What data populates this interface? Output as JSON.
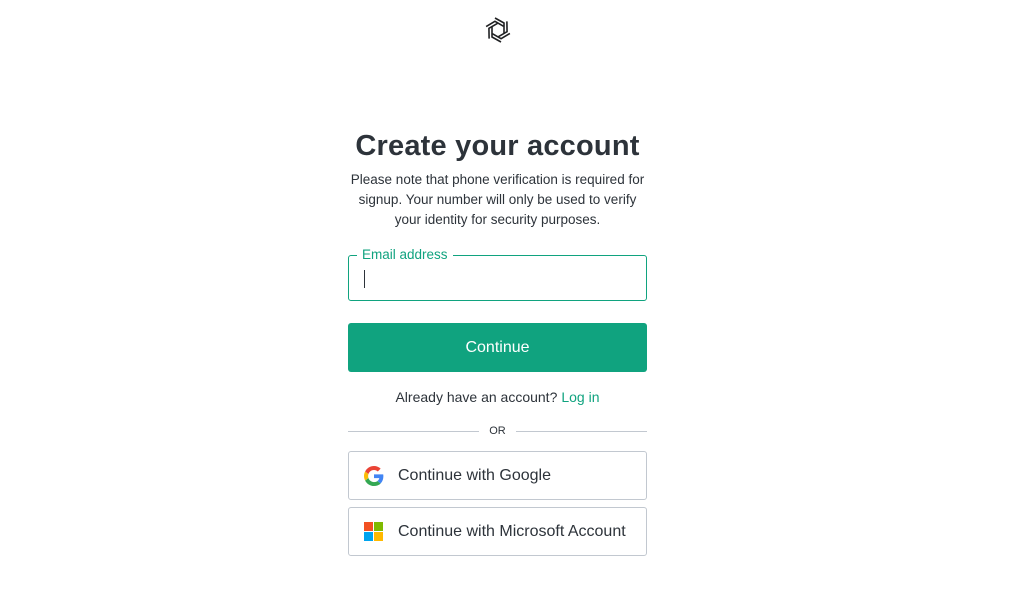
{
  "brand": {
    "logo_icon": "openai-logo-icon"
  },
  "header": {
    "title": "Create your account",
    "subtitle": "Please note that phone verification is required for signup. Your number will only be used to verify your identity for security purposes."
  },
  "form": {
    "email_label": "Email address",
    "email_value": "",
    "continue_label": "Continue"
  },
  "login": {
    "prompt": "Already have an account?",
    "link_label": "Log in"
  },
  "divider": {
    "text": "OR"
  },
  "social": {
    "google_label": "Continue with Google",
    "google_icon": "google-icon",
    "microsoft_label": "Continue with Microsoft Account",
    "microsoft_icon": "microsoft-icon"
  },
  "colors": {
    "accent": "#10a37f",
    "text": "#2d333a",
    "border": "#c2c8d0"
  }
}
